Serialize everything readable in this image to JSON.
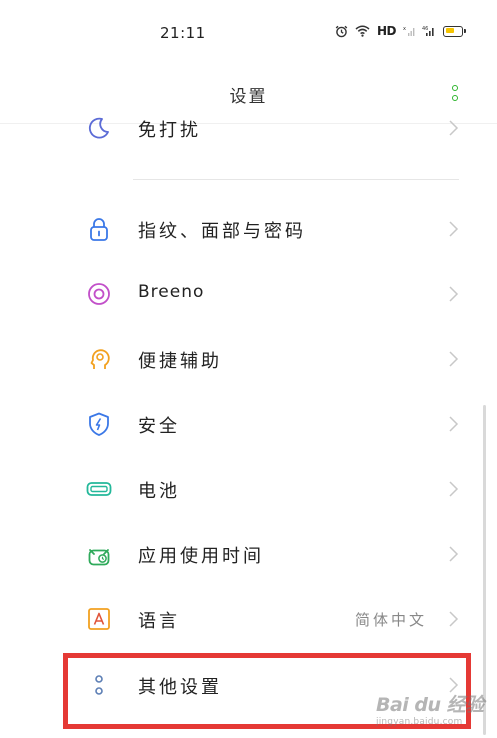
{
  "status_bar": {
    "time": "21:11",
    "network_label": "HD",
    "icons": [
      "alarm-icon",
      "wifi-icon",
      "signal-icon",
      "signal-icon",
      "battery-icon"
    ],
    "battery_color": "#f5c400"
  },
  "header": {
    "title": "设置",
    "menu_icon": "more-dots-icon"
  },
  "settings": {
    "items": [
      {
        "label": "免打扰",
        "icon": "moon-icon",
        "color": "#5b6bd6"
      },
      {
        "label": "指纹、面部与密码",
        "icon": "lock-icon",
        "color": "#3b78e7"
      },
      {
        "label": "Breeno",
        "icon": "breeno-icon",
        "color": "#c24fc9"
      },
      {
        "label": "便捷辅助",
        "icon": "assist-head-icon",
        "color": "#f2a120"
      },
      {
        "label": "安全",
        "icon": "shield-icon",
        "color": "#3b78e7"
      },
      {
        "label": "电池",
        "icon": "battery-icon",
        "color": "#23b89a"
      },
      {
        "label": "应用使用时间",
        "icon": "app-timer-icon",
        "color": "#2faa5b"
      },
      {
        "label": "语言",
        "value": "简体中文",
        "icon": "language-icon",
        "color": "#f2a120"
      },
      {
        "label": "其他设置",
        "icon": "other-settings-icon",
        "color": "#5d7fb5"
      }
    ]
  },
  "watermark": {
    "main": "Bai du 经验",
    "sub": "jingyan.baidu.com"
  },
  "colors": {
    "accent_green": "#2db52d",
    "highlight_red": "#e53935",
    "chevron": "#c8c8c8"
  }
}
